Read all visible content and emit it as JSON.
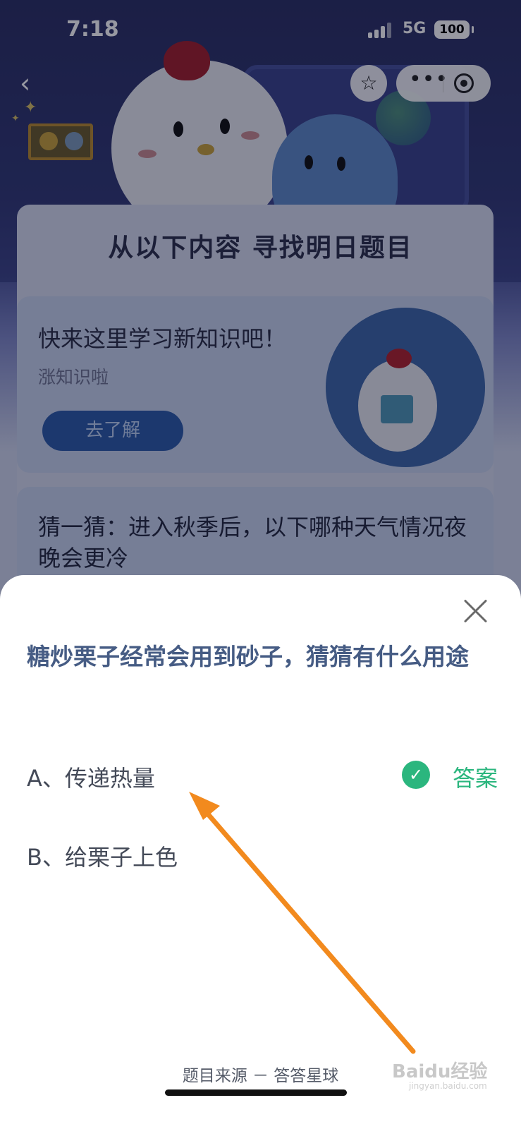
{
  "status_bar": {
    "time": "7:18",
    "network": "5G",
    "battery": "100"
  },
  "nav": {
    "back_icon": "chevron-left-icon",
    "favorite_icon": "star-icon",
    "more_icon": "more-dots-icon",
    "close_miniapp_icon": "target-icon"
  },
  "page": {
    "section_title": "从以下内容 寻找明日题目",
    "promo": {
      "title": "快来这里学习新知识吧！",
      "subtitle": "涨知识啦",
      "button": "去了解"
    },
    "guess_card": {
      "text": "猜一猜：进入秋季后，以下哪种天气情况夜晚会更冷"
    }
  },
  "sheet": {
    "close_icon": "close-icon",
    "question": "糖炒栗子经常会用到砂子，猜猜有什么用途",
    "options": [
      {
        "label": "A、传递热量",
        "is_answer": true
      },
      {
        "label": "B、给栗子上色",
        "is_answer": false
      }
    ],
    "answer_label": "答案",
    "answer_icon": "check-circle-icon",
    "source": "题目来源 － 答答星球"
  },
  "watermark": {
    "text": "Baidu经验",
    "sub": "jingyan.baidu.com"
  },
  "colors": {
    "question_text": "#465c84",
    "answer_green": "#2bb67e",
    "arrow_orange": "#f28a1e"
  }
}
